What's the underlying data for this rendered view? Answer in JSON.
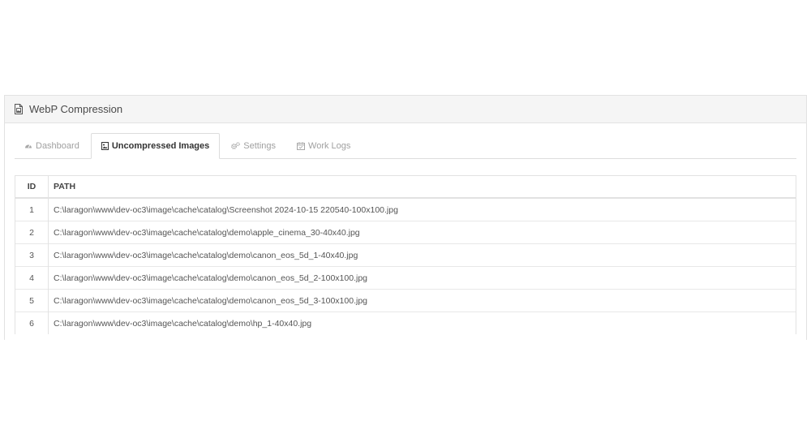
{
  "panel": {
    "title": "WebP Compression",
    "icon": "file-image-icon"
  },
  "tabs": [
    {
      "label": "Dashboard",
      "icon": "dashboard-icon",
      "active": false
    },
    {
      "label": "Uncompressed Images",
      "icon": "image-icon",
      "active": true
    },
    {
      "label": "Settings",
      "icon": "gears-icon",
      "active": false
    },
    {
      "label": "Work Logs",
      "icon": "calendar-icon",
      "active": false
    }
  ],
  "table": {
    "headers": {
      "id": "ID",
      "path": "PATH"
    },
    "rows": [
      {
        "id": "1",
        "path": "C:\\laragon\\www\\dev-oc3\\image\\cache\\catalog\\Screenshot 2024-10-15 220540-100x100.jpg"
      },
      {
        "id": "2",
        "path": "C:\\laragon\\www\\dev-oc3\\image\\cache\\catalog\\demo\\apple_cinema_30-40x40.jpg"
      },
      {
        "id": "3",
        "path": "C:\\laragon\\www\\dev-oc3\\image\\cache\\catalog\\demo\\canon_eos_5d_1-40x40.jpg"
      },
      {
        "id": "4",
        "path": "C:\\laragon\\www\\dev-oc3\\image\\cache\\catalog\\demo\\canon_eos_5d_2-100x100.jpg"
      },
      {
        "id": "5",
        "path": "C:\\laragon\\www\\dev-oc3\\image\\cache\\catalog\\demo\\canon_eos_5d_3-100x100.jpg"
      },
      {
        "id": "6",
        "path": "C:\\laragon\\www\\dev-oc3\\image\\cache\\catalog\\demo\\hp_1-40x40.jpg"
      }
    ]
  }
}
